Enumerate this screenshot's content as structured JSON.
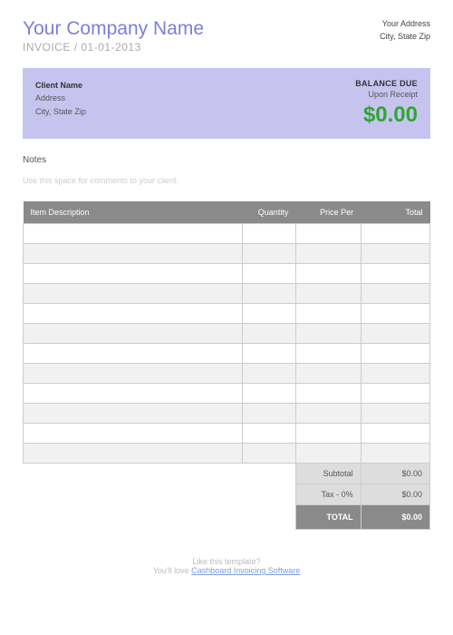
{
  "header": {
    "company_name": "Your Company Name",
    "invoice_word": "INVOICE",
    "separator": "/",
    "date": "01-01-2013",
    "address_line1": "Your Address",
    "address_line2": "City, State Zip"
  },
  "client": {
    "name": "Client Name",
    "address": "Address",
    "city_state_zip": "City, State Zip",
    "balance_label": "BALANCE DUE",
    "receipt_label": "Upon Receipt",
    "balance_amount": "$0.00"
  },
  "notes": {
    "label": "Notes",
    "hint": "Use this space for comments to your client."
  },
  "table": {
    "headers": {
      "description": "Item Description",
      "quantity": "Quantity",
      "price": "Price Per",
      "total": "Total"
    },
    "summary": {
      "subtotal_label": "Subtotal",
      "subtotal_value": "$0.00",
      "tax_label": "Tax - 0%",
      "tax_value": "$0.00",
      "total_label": "TOTAL",
      "total_value": "$0.00"
    }
  },
  "footer": {
    "line1": "Like this template?",
    "line2_prefix": "You'll love ",
    "link_text": "Cashboard Invoicing Software"
  }
}
